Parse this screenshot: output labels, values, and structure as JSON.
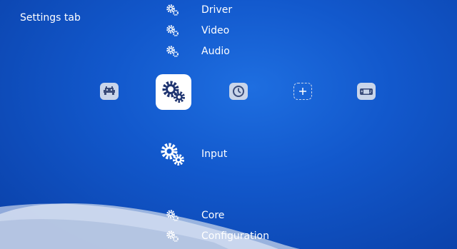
{
  "header": {
    "title": "Settings tab"
  },
  "colors": {
    "background_top": "#1e6ee0",
    "background_bottom": "#0a3fa6",
    "icon_fill": "#3a4c7a",
    "tab_fill": "#c9d5ea"
  },
  "tabs": [
    {
      "name": "main-menu",
      "icon": "invader-icon"
    },
    {
      "name": "settings",
      "icon": "gears-icon",
      "active": true
    },
    {
      "name": "history",
      "icon": "clock-icon"
    },
    {
      "name": "add",
      "icon": "plus-icon"
    },
    {
      "name": "gameboy",
      "icon": "handheld-console-icon"
    }
  ],
  "settings_menu": {
    "items_above": [
      {
        "label": "Driver"
      },
      {
        "label": "Video"
      },
      {
        "label": "Audio"
      }
    ],
    "selected": {
      "label": "Input"
    },
    "items_below": [
      {
        "label": "Core"
      },
      {
        "label": "Configuration"
      }
    ]
  }
}
